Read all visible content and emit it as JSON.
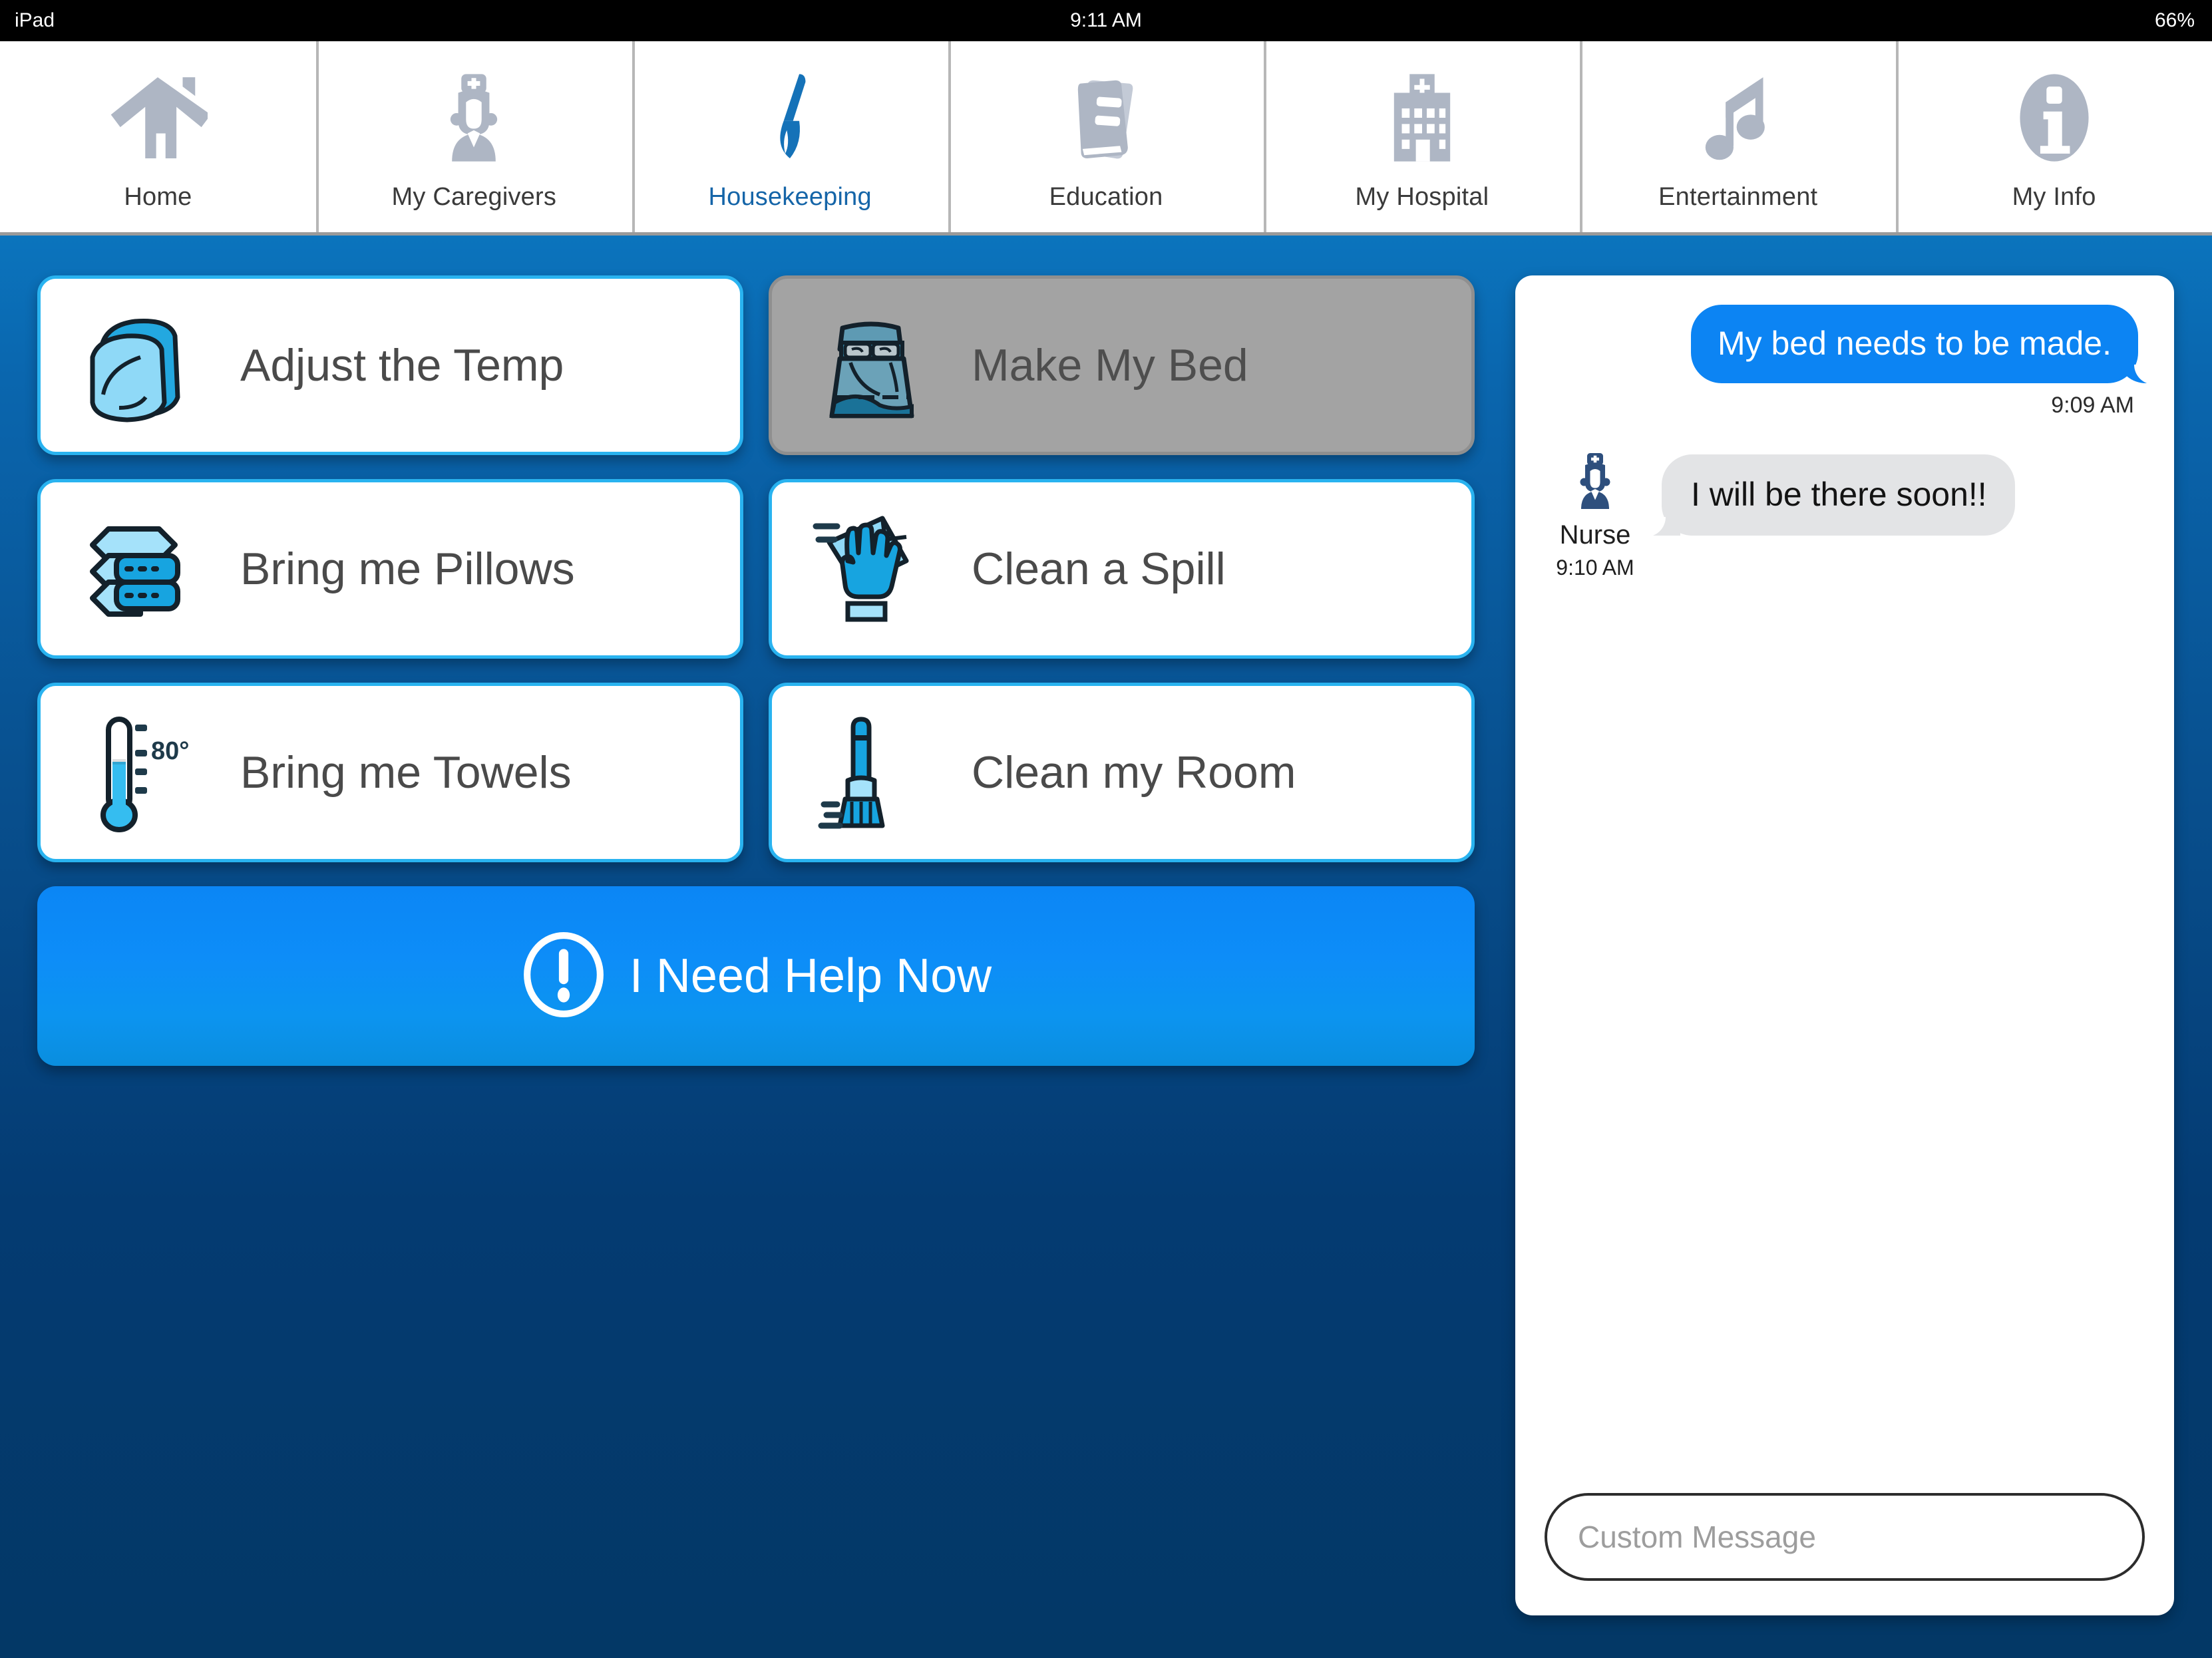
{
  "status_bar": {
    "device": "iPad",
    "time": "9:11 AM",
    "battery": "66%"
  },
  "nav": {
    "tabs": [
      {
        "label": "Home",
        "icon": "home-icon",
        "active": false
      },
      {
        "label": "My Caregivers",
        "icon": "nurse-icon",
        "active": false
      },
      {
        "label": "Housekeeping",
        "icon": "broom-icon",
        "active": true
      },
      {
        "label": "Education",
        "icon": "book-icon",
        "active": false
      },
      {
        "label": "My Hospital",
        "icon": "hospital-icon",
        "active": false
      },
      {
        "label": "Entertainment",
        "icon": "music-note-icon",
        "active": false
      },
      {
        "label": "My Info",
        "icon": "info-circle-icon",
        "active": false
      }
    ]
  },
  "actions": {
    "buttons": [
      {
        "label": "Adjust the Temp",
        "icon": "pillow-icon",
        "selected": false
      },
      {
        "label": "Make My Bed",
        "icon": "bed-icon",
        "selected": true
      },
      {
        "label": "Bring me Pillows",
        "icon": "stacked-linen-icon",
        "selected": false
      },
      {
        "label": "Clean a Spill",
        "icon": "gloved-hand-icon",
        "selected": false
      },
      {
        "label": "Bring me Towels",
        "icon": "thermometer-icon",
        "selected": false
      },
      {
        "label": "Clean my Room",
        "icon": "broom-icon",
        "selected": false
      }
    ],
    "thermometer_reading": "80°",
    "help": {
      "label": "I Need Help Now",
      "icon": "exclamation-circle-icon"
    }
  },
  "chat": {
    "outgoing": {
      "text": "My bed needs to be made.",
      "time": "9:09 AM"
    },
    "incoming": {
      "sender": "Nurse",
      "text": "I will be there soon!!",
      "time": "9:10 AM",
      "avatar": "nurse-avatar-icon"
    },
    "compose": {
      "value": "",
      "placeholder": "Custom Message"
    }
  },
  "colors": {
    "accent_blue": "#0c84f3",
    "tab_active": "#1565a8",
    "card_border": "#29b3f0",
    "selected_gray": "#a3a3a3",
    "stage_top": "#0b74bd",
    "stage_bottom": "#033866",
    "icon_gray": "#aeb6c4",
    "nurse_navy": "#2e4f7d"
  }
}
